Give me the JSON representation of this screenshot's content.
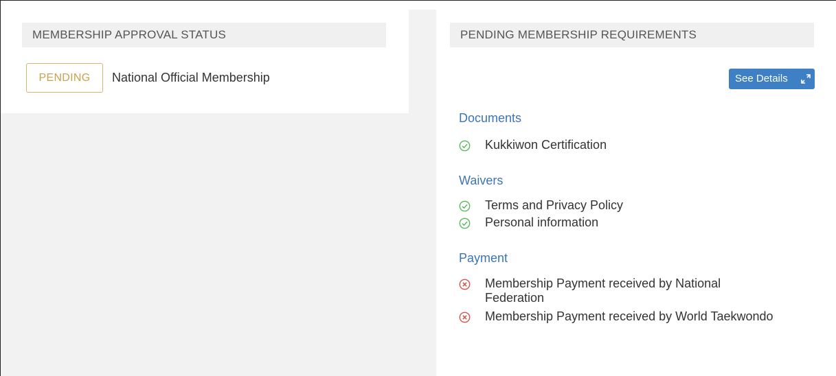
{
  "left_panel": {
    "header": "MEMBERSHIP APPROVAL STATUS",
    "status_badge": "PENDING",
    "membership_name": "National Official Membership"
  },
  "right_panel": {
    "header": "PENDING MEMBERSHIP REQUIREMENTS",
    "details_button": "See Details",
    "groups": [
      {
        "title": "Documents",
        "items": [
          {
            "label": "Kukkiwon Certification",
            "status": "complete"
          }
        ]
      },
      {
        "title": "Waivers",
        "items": [
          {
            "label": "Terms and Privacy Policy",
            "status": "complete"
          },
          {
            "label": "Personal information",
            "status": "complete"
          }
        ]
      },
      {
        "title": "Payment",
        "items": [
          {
            "label": "Membership Payment received by National Federation",
            "status": "incomplete"
          },
          {
            "label": "Membership Payment received by World Taekwondo",
            "status": "incomplete"
          }
        ]
      }
    ]
  },
  "icons": {
    "complete": "check-circle-icon",
    "incomplete": "x-circle-icon",
    "details": "expand-arrows-icon"
  },
  "colors": {
    "accent_blue": "#3f7fc4",
    "heading_blue": "#3b74b8",
    "pending_gold": "#c9a24f",
    "success_green": "#5cb85c",
    "error_red": "#d9534f"
  }
}
